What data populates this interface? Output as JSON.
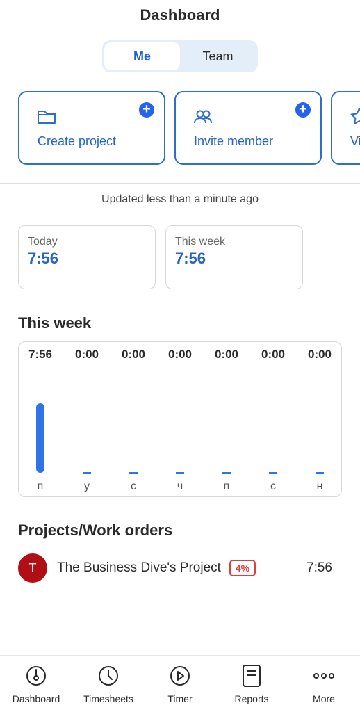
{
  "header": {
    "title": "Dashboard"
  },
  "segment": {
    "options": [
      "Me",
      "Team"
    ],
    "selected": "Me"
  },
  "actions": [
    {
      "label": "Create project",
      "icon": "folder-icon"
    },
    {
      "label": "Invite member",
      "icon": "users-icon"
    },
    {
      "label": "Vi",
      "icon": "star-icon"
    }
  ],
  "status": {
    "updated": "Updated less than a minute ago"
  },
  "stats": [
    {
      "label": "Today",
      "value": "7:56"
    },
    {
      "label": "This week",
      "value": "7:56"
    }
  ],
  "week": {
    "title": "This week",
    "days": [
      "п",
      "у",
      "с",
      "ч",
      "п",
      "с",
      "н"
    ],
    "times": [
      "7:56",
      "0:00",
      "0:00",
      "0:00",
      "0:00",
      "0:00",
      "0:00"
    ],
    "hours": [
      7.93,
      0,
      0,
      0,
      0,
      0,
      0
    ],
    "bar_color": "#2f73e8"
  },
  "projects": {
    "title": "Projects/Work orders",
    "items": [
      {
        "initial": "T",
        "name": "The Business Dive's Project",
        "badge": "4%",
        "time": "7:56",
        "avatar_color": "#b00f16"
      }
    ]
  },
  "nav": [
    {
      "label": "Dashboard",
      "icon": "dashboard-icon"
    },
    {
      "label": "Timesheets",
      "icon": "clock-icon"
    },
    {
      "label": "Timer",
      "icon": "play-icon"
    },
    {
      "label": "Reports",
      "icon": "reports-icon"
    },
    {
      "label": "More",
      "icon": "more-icon"
    }
  ]
}
